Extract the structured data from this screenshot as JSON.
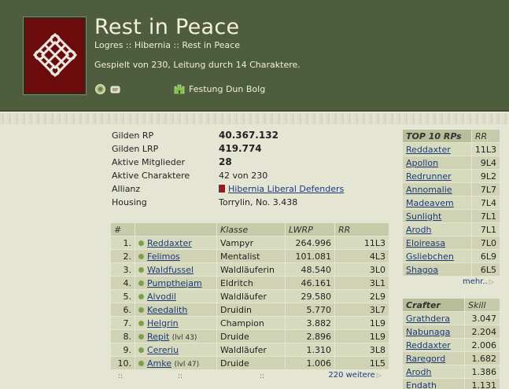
{
  "header": {
    "title": "Rest in Peace",
    "breadcrumb": "Logres :: Hibernia :: Rest in Peace",
    "played_by": "Gespielt von 230, Leitung durch 14 Charaktere.",
    "fortress": "Festung Dun Bolg"
  },
  "info": {
    "guild_rp_label": "Gilden RP",
    "guild_rp": "40.367.132",
    "guild_lrp_label": "Gilden LRP",
    "guild_lrp": "419.774",
    "active_members_label": "Aktive Mitglieder",
    "active_members": "28",
    "active_chars_label": "Aktive Charaktere",
    "active_chars": "42 von 230",
    "alliance_label": "Allianz",
    "alliance": "Hibernia Liberal Defenders",
    "housing_label": "Housing",
    "housing": "Torrylin, No. 3.438"
  },
  "members": {
    "headers": [
      "#",
      "",
      "Klasse",
      "LWRP",
      "RR"
    ],
    "rows": [
      {
        "num": "1.",
        "name": "Reddaxter",
        "lvl": "",
        "klasse": "Vampyr",
        "lwrp": "264.996",
        "rr": "11L3"
      },
      {
        "num": "2.",
        "name": "Felimos",
        "lvl": "",
        "klasse": "Mentalist",
        "lwrp": "101.081",
        "rr": "4L3"
      },
      {
        "num": "3.",
        "name": "Waldfussel",
        "lvl": "",
        "klasse": "Waldläuferin",
        "lwrp": "48.540",
        "rr": "3L0"
      },
      {
        "num": "4.",
        "name": "Pumpthejam",
        "lvl": "",
        "klasse": "Eldritch",
        "lwrp": "46.161",
        "rr": "3L1"
      },
      {
        "num": "5.",
        "name": "Alvodil",
        "lvl": "",
        "klasse": "Waldläufer",
        "lwrp": "29.580",
        "rr": "2L9"
      },
      {
        "num": "6.",
        "name": "Keedalith",
        "lvl": "",
        "klasse": "Druidin",
        "lwrp": "5.770",
        "rr": "3L7"
      },
      {
        "num": "7.",
        "name": "Helgrin",
        "lvl": "",
        "klasse": "Champion",
        "lwrp": "3.882",
        "rr": "1L9"
      },
      {
        "num": "8.",
        "name": "Repit",
        "lvl": "(lvl 43)",
        "klasse": "Druide",
        "lwrp": "2.896",
        "rr": "1L9"
      },
      {
        "num": "9.",
        "name": "Cereriu",
        "lvl": "",
        "klasse": "Waldläufer",
        "lwrp": "1.310",
        "rr": "3L8"
      },
      {
        "num": "10.",
        "name": "Amke",
        "lvl": "(lvl 47)",
        "klasse": "Druide",
        "lwrp": "1.006",
        "rr": "1L5"
      }
    ],
    "more": "220 weitere",
    "colons": "::"
  },
  "top10": {
    "title": "TOP 10 RPs",
    "rr_header": "RR",
    "rows": [
      {
        "name": "Reddaxter",
        "rr": "11L3"
      },
      {
        "name": "Apollon",
        "rr": "9L4"
      },
      {
        "name": "Redrunner",
        "rr": "9L2"
      },
      {
        "name": "Annomalie",
        "rr": "7L7"
      },
      {
        "name": "Madeavem",
        "rr": "7L4"
      },
      {
        "name": "Sunlight",
        "rr": "7L1"
      },
      {
        "name": "Arodh",
        "rr": "7L1"
      },
      {
        "name": "Eloireasa",
        "rr": "7L0"
      },
      {
        "name": "Gsliebchen",
        "rr": "6L9"
      },
      {
        "name": "Shagoa",
        "rr": "6L5"
      }
    ],
    "more": "mehr.."
  },
  "crafters": {
    "title": "Crafter",
    "skill_header": "Skill",
    "rows": [
      {
        "name": "Grathdera",
        "skill": "3.047"
      },
      {
        "name": "Nabunaga",
        "skill": "2.204"
      },
      {
        "name": "Reddaxter",
        "skill": "2.006"
      },
      {
        "name": "Raregord",
        "skill": "1.682"
      },
      {
        "name": "Arodh",
        "skill": "1.386"
      },
      {
        "name": "Endath",
        "skill": "1.131"
      }
    ]
  },
  "colors": {
    "header_bg": "#4f5d3f",
    "logo_bg": "#6b0b0b",
    "link": "#1d3a7a",
    "online_dot": "#7aa04a"
  }
}
